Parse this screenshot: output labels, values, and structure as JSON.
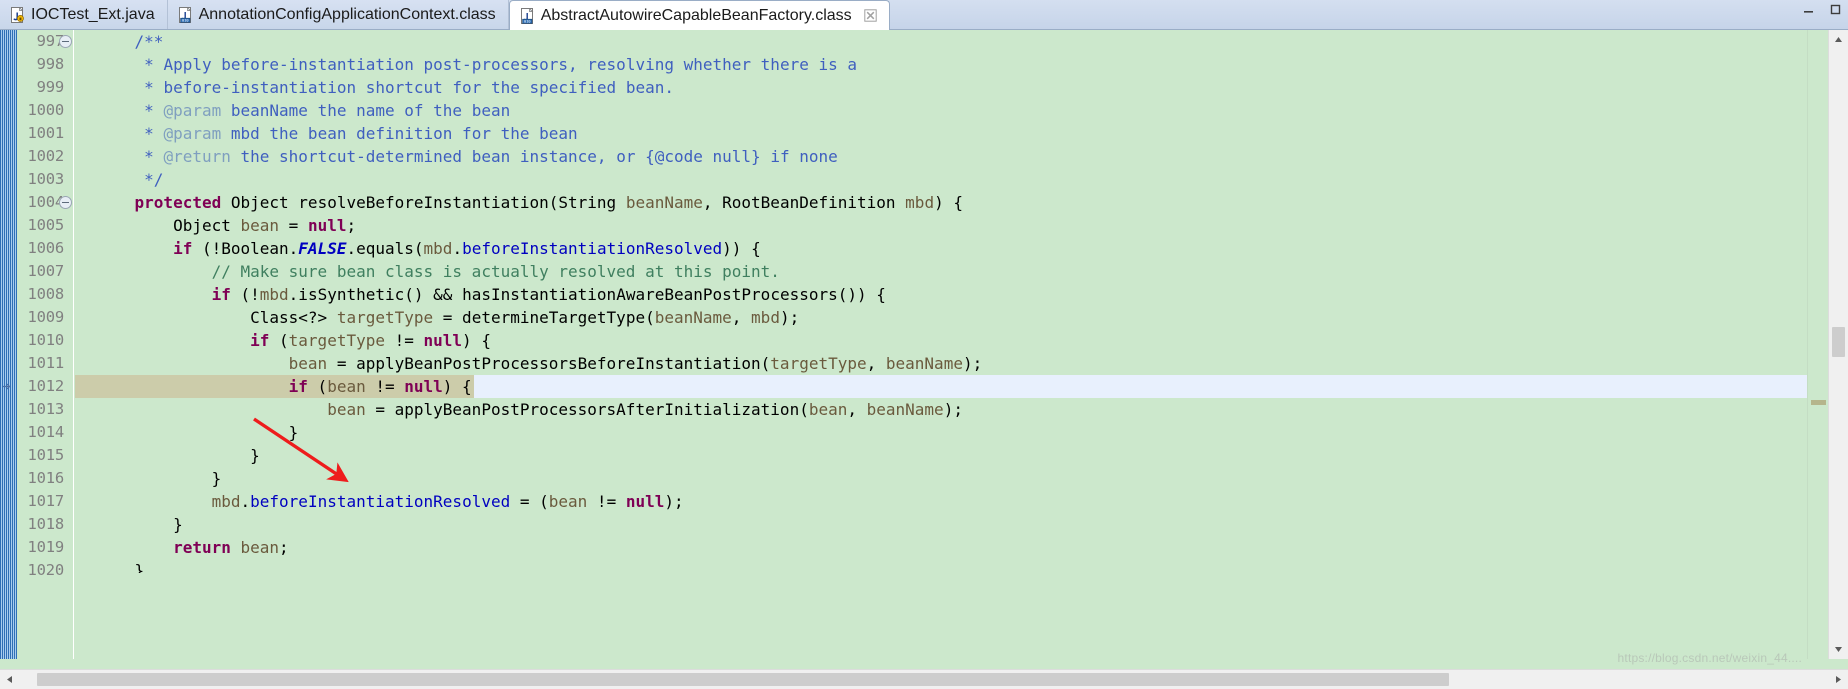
{
  "window": {
    "controls": [
      {
        "name": "minimize-button",
        "glyph": "─"
      },
      {
        "name": "maximize-button",
        "glyph": "□"
      }
    ]
  },
  "tabbar": {
    "tabs": [
      {
        "label": "IOCTest_Ext.java",
        "icon": "java-source-file-icon",
        "active": false,
        "closable": false
      },
      {
        "label": "AnnotationConfigApplicationContext.class",
        "icon": "java-class-file-icon",
        "active": false,
        "closable": false
      },
      {
        "label": "AbstractAutowireCapableBeanFactory.class",
        "icon": "java-class-file-icon",
        "active": true,
        "closable": true,
        "close_glyph": "☒"
      }
    ]
  },
  "editor": {
    "first_line": 997,
    "current_line": 1012,
    "fold_lines": [
      997,
      1004
    ],
    "colors": {
      "background": "#cce8cc",
      "current_line": "#ccccaa",
      "caret_trail": "#e8f0fd",
      "line_number": "#808080",
      "keyword": "#7f0055",
      "javadoc": "#3f5fbf",
      "javadoc_tag": "#7f9fbf",
      "field": "#0000c0",
      "local_var": "#6a5a3d",
      "line_comment": "#3f7f5f"
    },
    "lines": [
      {
        "num": 997,
        "fold": true,
        "tokens": [
          {
            "t": "    ",
            "c": "pl"
          },
          {
            "t": "/**",
            "c": "cmt"
          }
        ]
      },
      {
        "num": 998,
        "tokens": [
          {
            "t": "     * ",
            "c": "cmt"
          },
          {
            "t": "Apply before-instantiation post-processors, resolving whether there is a",
            "c": "cmt"
          }
        ]
      },
      {
        "num": 999,
        "tokens": [
          {
            "t": "     * ",
            "c": "cmt"
          },
          {
            "t": "before-instantiation shortcut for the specified bean.",
            "c": "cmt"
          }
        ]
      },
      {
        "num": 1000,
        "tokens": [
          {
            "t": "     * ",
            "c": "cmt"
          },
          {
            "t": "@param",
            "c": "tag"
          },
          {
            "t": " beanName the name of the bean",
            "c": "cmt"
          }
        ]
      },
      {
        "num": 1001,
        "tokens": [
          {
            "t": "     * ",
            "c": "cmt"
          },
          {
            "t": "@param",
            "c": "tag"
          },
          {
            "t": " mbd the bean definition for the bean",
            "c": "cmt"
          }
        ]
      },
      {
        "num": 1002,
        "tokens": [
          {
            "t": "     * ",
            "c": "cmt"
          },
          {
            "t": "@return",
            "c": "tag"
          },
          {
            "t": " the shortcut-determined bean instance, or {@code null} if none",
            "c": "cmt"
          }
        ]
      },
      {
        "num": 1003,
        "tokens": [
          {
            "t": "     */",
            "c": "cmt"
          }
        ]
      },
      {
        "num": 1004,
        "fold": true,
        "tokens": [
          {
            "t": "    ",
            "c": "pl"
          },
          {
            "t": "protected",
            "c": "kw"
          },
          {
            "t": " Object resolveBeforeInstantiation(String ",
            "c": "pl"
          },
          {
            "t": "beanName",
            "c": "par"
          },
          {
            "t": ", RootBeanDefinition ",
            "c": "pl"
          },
          {
            "t": "mbd",
            "c": "par"
          },
          {
            "t": ") {",
            "c": "pl"
          }
        ]
      },
      {
        "num": 1005,
        "tokens": [
          {
            "t": "        Object ",
            "c": "pl"
          },
          {
            "t": "bean",
            "c": "loc"
          },
          {
            "t": " = ",
            "c": "pl"
          },
          {
            "t": "null",
            "c": "kw"
          },
          {
            "t": ";",
            "c": "pl"
          }
        ]
      },
      {
        "num": 1006,
        "tokens": [
          {
            "t": "        ",
            "c": "pl"
          },
          {
            "t": "if",
            "c": "kw"
          },
          {
            "t": " (!Boolean.",
            "c": "pl"
          },
          {
            "t": "FALSE",
            "c": "fldi"
          },
          {
            "t": ".equals(",
            "c": "pl"
          },
          {
            "t": "mbd",
            "c": "par"
          },
          {
            "t": ".",
            "c": "pl"
          },
          {
            "t": "beforeInstantiationResolved",
            "c": "fld"
          },
          {
            "t": ")) {",
            "c": "pl"
          }
        ]
      },
      {
        "num": 1007,
        "tokens": [
          {
            "t": "            ",
            "c": "pl"
          },
          {
            "t": "// Make sure bean class is actually resolved at this point.",
            "c": "slcmt"
          }
        ]
      },
      {
        "num": 1008,
        "tokens": [
          {
            "t": "            ",
            "c": "pl"
          },
          {
            "t": "if",
            "c": "kw"
          },
          {
            "t": " (!",
            "c": "pl"
          },
          {
            "t": "mbd",
            "c": "par"
          },
          {
            "t": ".isSynthetic() && hasInstantiationAwareBeanPostProcessors()) {",
            "c": "pl"
          }
        ]
      },
      {
        "num": 1009,
        "tokens": [
          {
            "t": "                Class<?> ",
            "c": "pl"
          },
          {
            "t": "targetType",
            "c": "loc"
          },
          {
            "t": " = determineTargetType(",
            "c": "pl"
          },
          {
            "t": "beanName",
            "c": "par"
          },
          {
            "t": ", ",
            "c": "pl"
          },
          {
            "t": "mbd",
            "c": "par"
          },
          {
            "t": ");",
            "c": "pl"
          }
        ]
      },
      {
        "num": 1010,
        "tokens": [
          {
            "t": "                ",
            "c": "pl"
          },
          {
            "t": "if",
            "c": "kw"
          },
          {
            "t": " (",
            "c": "pl"
          },
          {
            "t": "targetType",
            "c": "loc"
          },
          {
            "t": " != ",
            "c": "pl"
          },
          {
            "t": "null",
            "c": "kw"
          },
          {
            "t": ") {",
            "c": "pl"
          }
        ]
      },
      {
        "num": 1011,
        "tokens": [
          {
            "t": "                    ",
            "c": "pl"
          },
          {
            "t": "bean",
            "c": "loc"
          },
          {
            "t": " = applyBeanPostProcessorsBeforeInstantiation(",
            "c": "pl"
          },
          {
            "t": "targetType",
            "c": "loc"
          },
          {
            "t": ", ",
            "c": "pl"
          },
          {
            "t": "beanName",
            "c": "par"
          },
          {
            "t": ");",
            "c": "pl"
          }
        ]
      },
      {
        "num": 1012,
        "current": true,
        "tokens": [
          {
            "t": "                    ",
            "c": "pl"
          },
          {
            "t": "if",
            "c": "kw"
          },
          {
            "t": " (",
            "c": "pl"
          },
          {
            "t": "bean",
            "c": "loc"
          },
          {
            "t": " != ",
            "c": "pl"
          },
          {
            "t": "null",
            "c": "kw"
          },
          {
            "t": ") {",
            "c": "pl"
          }
        ]
      },
      {
        "num": 1013,
        "tokens": [
          {
            "t": "                        ",
            "c": "pl"
          },
          {
            "t": "bean",
            "c": "loc"
          },
          {
            "t": " = applyBeanPostProcessorsAfterInitialization(",
            "c": "pl"
          },
          {
            "t": "bean",
            "c": "loc"
          },
          {
            "t": ", ",
            "c": "pl"
          },
          {
            "t": "beanName",
            "c": "par"
          },
          {
            "t": ");",
            "c": "pl"
          }
        ]
      },
      {
        "num": 1014,
        "tokens": [
          {
            "t": "                    }",
            "c": "pl"
          }
        ]
      },
      {
        "num": 1015,
        "tokens": [
          {
            "t": "                }",
            "c": "pl"
          }
        ]
      },
      {
        "num": 1016,
        "tokens": [
          {
            "t": "            }",
            "c": "pl"
          }
        ]
      },
      {
        "num": 1017,
        "tokens": [
          {
            "t": "            ",
            "c": "pl"
          },
          {
            "t": "mbd",
            "c": "par"
          },
          {
            "t": ".",
            "c": "pl"
          },
          {
            "t": "beforeInstantiationResolved",
            "c": "fld"
          },
          {
            "t": " = (",
            "c": "pl"
          },
          {
            "t": "bean",
            "c": "loc"
          },
          {
            "t": " != ",
            "c": "pl"
          },
          {
            "t": "null",
            "c": "kw"
          },
          {
            "t": ");",
            "c": "pl"
          }
        ]
      },
      {
        "num": 1018,
        "tokens": [
          {
            "t": "        }",
            "c": "pl"
          }
        ]
      },
      {
        "num": 1019,
        "tokens": [
          {
            "t": "        ",
            "c": "pl"
          },
          {
            "t": "return",
            "c": "kw"
          },
          {
            "t": " ",
            "c": "pl"
          },
          {
            "t": "bean",
            "c": "loc"
          },
          {
            "t": ";",
            "c": "pl"
          }
        ]
      },
      {
        "num": 1020,
        "clipped": true,
        "tokens": [
          {
            "t": "    }",
            "c": "pl"
          }
        ]
      }
    ]
  },
  "scrollbars": {
    "vertical": {
      "up_glyph": "▲",
      "down_glyph": "▼",
      "thumb_top_pct": 47,
      "thumb_height_pct": 5
    },
    "horizontal": {
      "left_glyph": "◀",
      "right_glyph": "▶",
      "thumb_left_pct": 1,
      "thumb_width_pct": 78
    }
  },
  "annotation": {
    "arrow_color": "#ee1c1c",
    "description": "red-arrow-pointing-to-line-1012"
  },
  "watermark": {
    "text": "https://blog.csdn.net/weixin_44...."
  }
}
